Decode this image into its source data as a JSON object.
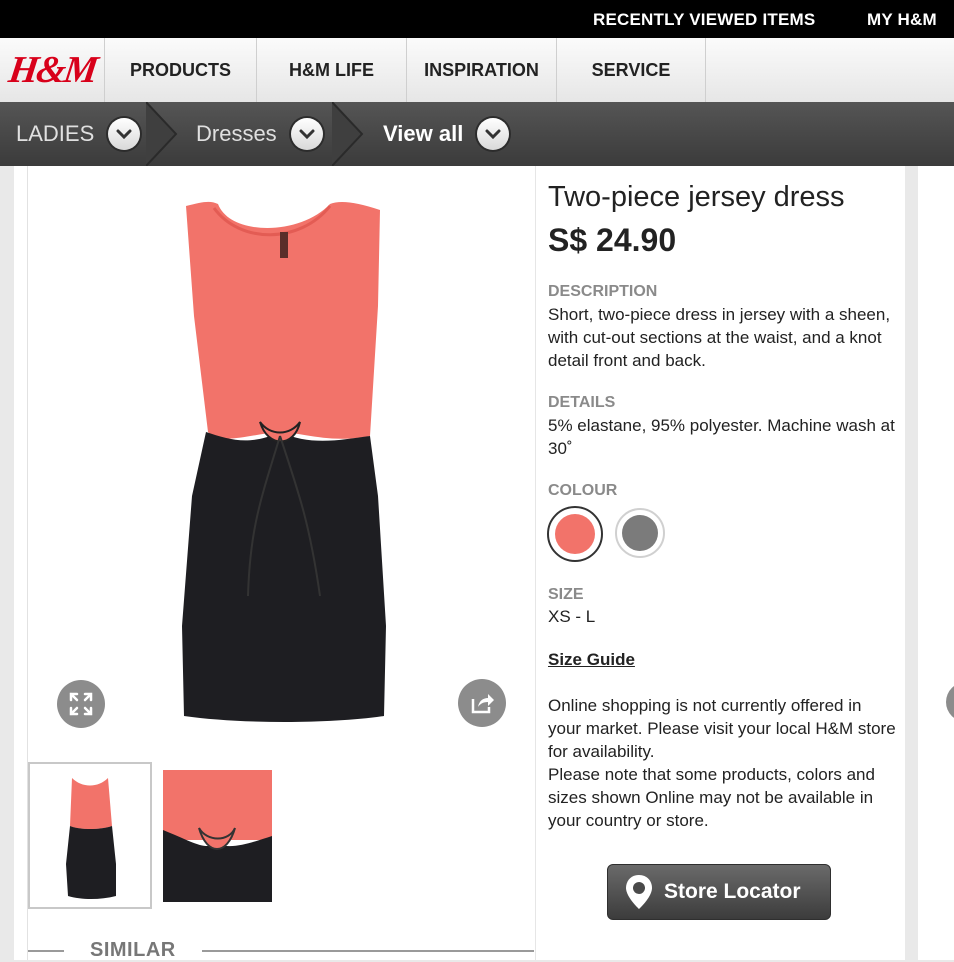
{
  "topbar": {
    "recently_viewed": "RECENTLY VIEWED ITEMS",
    "my_hm": "MY H&M"
  },
  "logo": {
    "text": "H&M"
  },
  "nav": {
    "items": [
      {
        "label": "PRODUCTS"
      },
      {
        "label": "H&M LIFE"
      },
      {
        "label": "INSPIRATION"
      },
      {
        "label": "SERVICE"
      }
    ]
  },
  "breadcrumbs": [
    {
      "label": "LADIES"
    },
    {
      "label": "Dresses"
    },
    {
      "label": "View all"
    }
  ],
  "product": {
    "name": "Two-piece jersey dress",
    "price": "S$ 24.90",
    "description_label": "DESCRIPTION",
    "description": "Short, two-piece dress in jersey with a sheen, with cut-out sections at the waist, and a knot detail front and back.",
    "details_label": "DETAILS",
    "details": "5% elastane, 95% polyester. Machine wash at 30˚",
    "colour_label": "COLOUR",
    "colours": [
      "#f2736a",
      "#7b7b7b"
    ],
    "size_label": "SIZE",
    "size_value": "XS - L",
    "size_guide": "Size Guide",
    "notice_1": "Online shopping is not currently offered in your market. Please visit your local H&M store for availability.",
    "notice_2": "Please note that some products, colors and sizes shown Online may not be available in your country or store.",
    "store_locator": "Store Locator"
  },
  "similar": {
    "label": "SIMILAR"
  },
  "icons": {
    "expand": "expand-icon",
    "share": "share-icon",
    "chevron": "chevron-down-icon",
    "pin": "map-pin-icon"
  }
}
